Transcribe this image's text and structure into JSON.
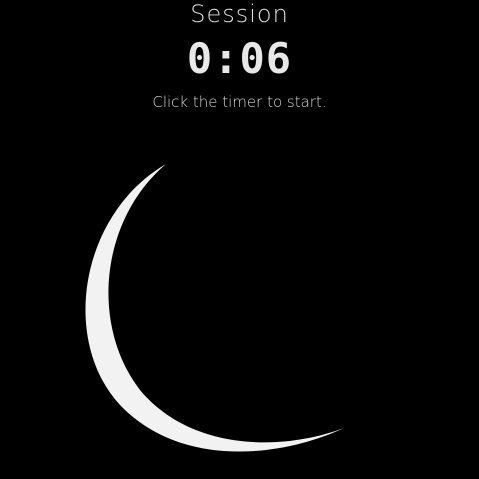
{
  "session": {
    "label": "Session"
  },
  "timer": {
    "display": "0:06"
  },
  "hint": {
    "text": "Click the timer to start."
  },
  "moon": {
    "icon": "crescent-moon-icon",
    "color": "#f2f2f2"
  },
  "colors": {
    "background": "#000000",
    "text": "#e6e6e6"
  }
}
